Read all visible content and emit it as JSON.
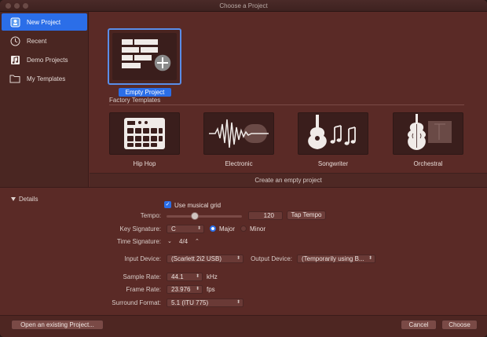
{
  "window": {
    "title": "Choose a Project"
  },
  "sidebar": {
    "items": [
      {
        "label": "New Project",
        "icon": "logic-project-icon",
        "active": true
      },
      {
        "label": "Recent",
        "icon": "clock-icon",
        "active": false
      },
      {
        "label": "Demo Projects",
        "icon": "music-note-icon",
        "active": false
      },
      {
        "label": "My Templates",
        "icon": "folder-icon",
        "active": false
      }
    ]
  },
  "main": {
    "empty_project_label": "Empty Project",
    "factory_templates_label": "Factory Templates",
    "templates": [
      {
        "label": "Hip Hop",
        "icon": "drum-machine-icon"
      },
      {
        "label": "Electronic",
        "icon": "waveform-icon"
      },
      {
        "label": "Songwriter",
        "icon": "guitar-icon"
      },
      {
        "label": "Orchestral",
        "icon": "violin-icon"
      }
    ],
    "description": "Create an empty project"
  },
  "details": {
    "toggle_label": "Details",
    "use_musical_grid": "Use musical grid",
    "tempo_label": "Tempo:",
    "tempo_value": "120",
    "tap_tempo": "Tap Tempo",
    "key_signature_label": "Key Signature:",
    "key_value": "C",
    "major_label": "Major",
    "minor_label": "Minor",
    "time_signature_label": "Time Signature:",
    "time_signature_value": "4/4",
    "input_device_label": "Input Device:",
    "input_device_value": "(Scarlett 2i2 USB)",
    "output_device_label": "Output Device:",
    "output_device_value": "(Temporarily using B...",
    "sample_rate_label": "Sample Rate:",
    "sample_rate_value": "44.1",
    "sample_rate_unit": "kHz",
    "frame_rate_label": "Frame Rate:",
    "frame_rate_value": "23.976",
    "frame_rate_unit": "fps",
    "surround_format_label": "Surround Format:",
    "surround_format_value": "5.1 (ITU 775)"
  },
  "footer": {
    "open_existing": "Open an existing Project...",
    "cancel": "Cancel",
    "choose": "Choose"
  },
  "colors": {
    "accent": "#2b6ee8",
    "background": "#5a2a26",
    "sidebar": "#4a2622"
  }
}
